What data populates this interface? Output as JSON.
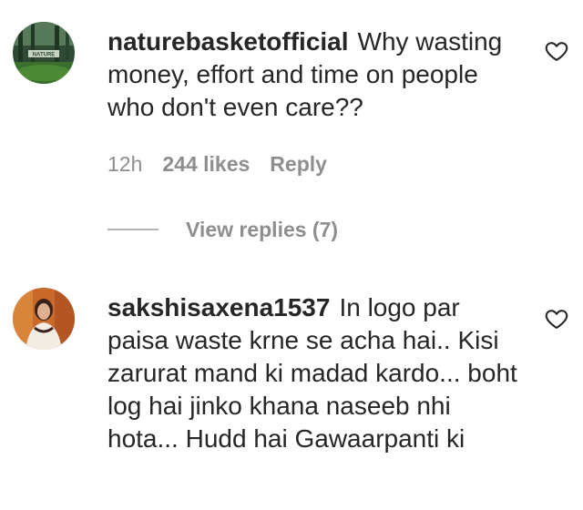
{
  "comments": [
    {
      "username": "naturebasketofficial",
      "text": "Why wasting money, effort and time on people who don't even care??",
      "time": "12h",
      "likes": "244 likes",
      "reply": "Reply",
      "view_replies": "View replies (7)",
      "avatar_caption": "NATURE"
    },
    {
      "username": "sakshisaxena1537",
      "text": "In logo par paisa waste krne se acha hai.. Kisi zarurat mand ki madad kardo... boht log hai jinko khana naseeb nhi hota... Hudd hai Gawaarpanti ki"
    }
  ],
  "icons": {
    "like": "heart-outline-icon"
  },
  "colors": {
    "text": "#262626",
    "secondary": "#8e8e8e"
  }
}
